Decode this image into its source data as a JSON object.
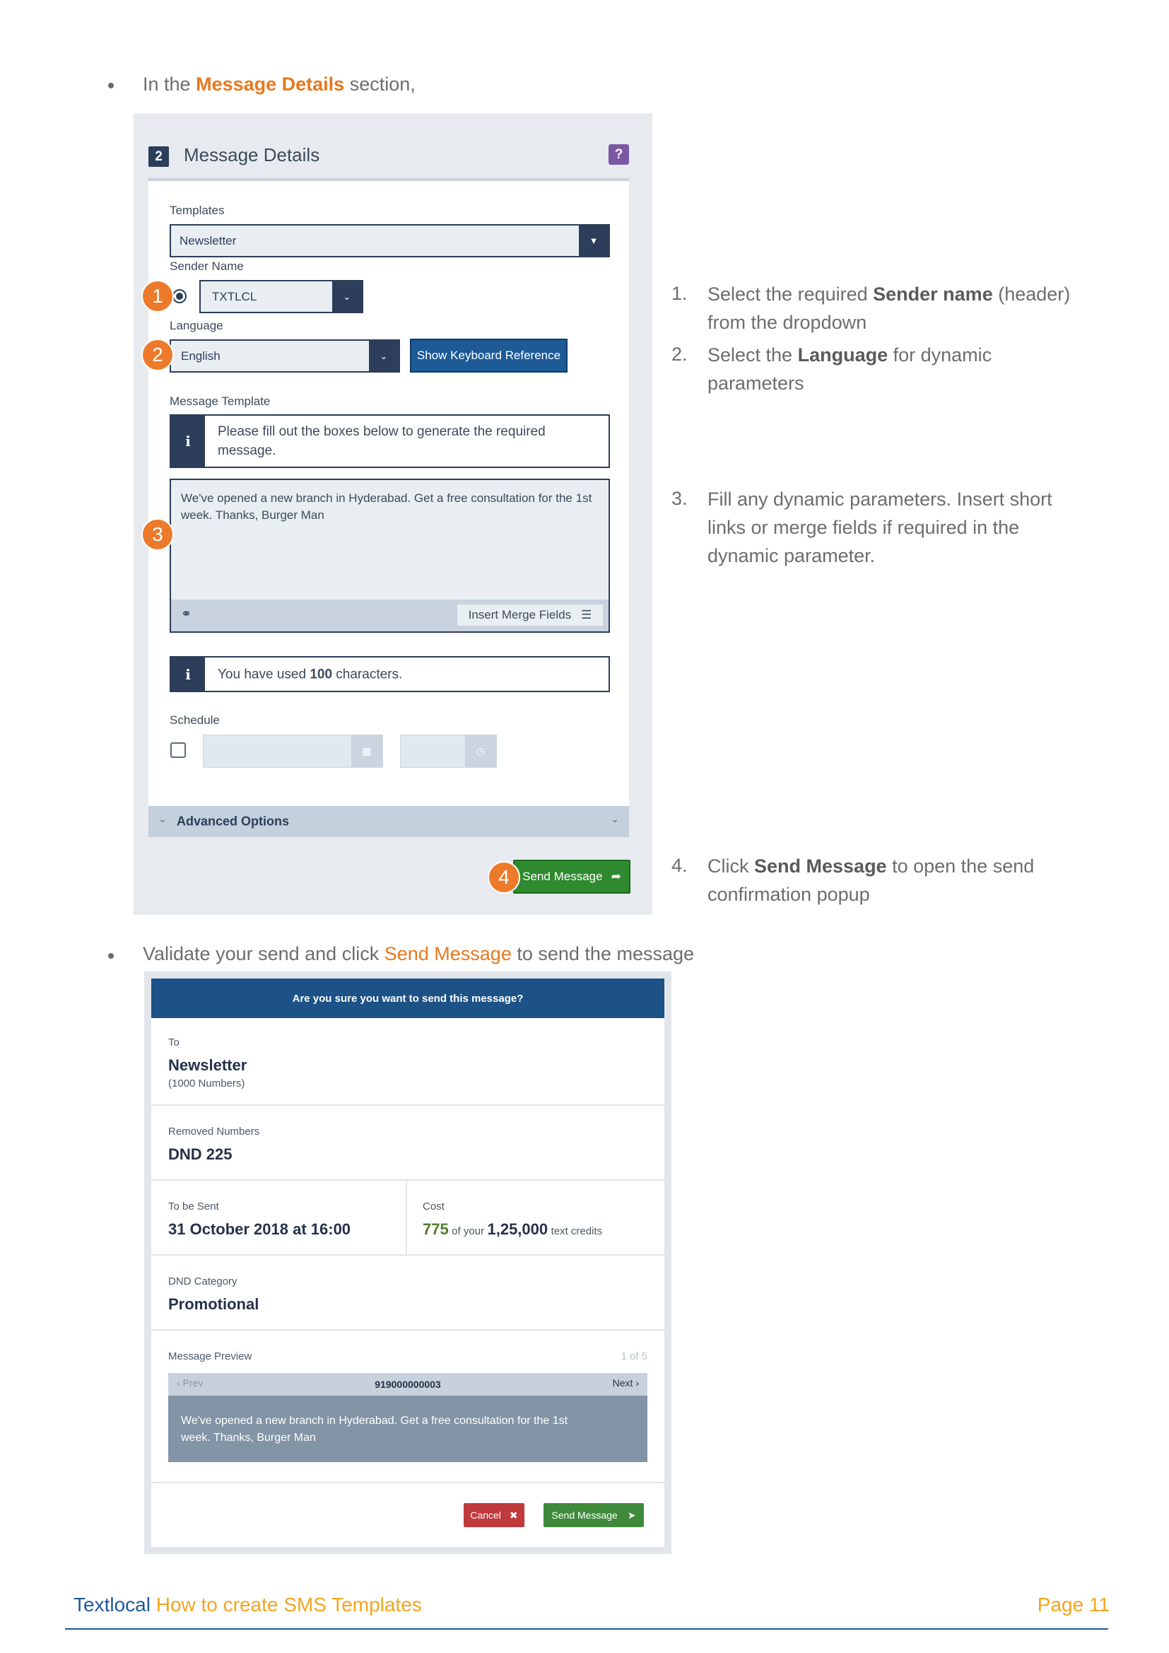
{
  "intro": {
    "prefix": "In the",
    "highlight": "Message Details",
    "suffix": "section,"
  },
  "panel": {
    "step_number": "2",
    "title": "Message Details",
    "help": "?",
    "templates_label": "Templates",
    "templates_value": "Newsletter",
    "sender_label": "Sender Name",
    "sender_value": "TXTLCL",
    "language_label": "Language",
    "language_value": "English",
    "keyboard_button": "Show Keyboard Reference",
    "message_template_label": "Message Template",
    "info_text": "Please fill out the boxes below to generate the required message.",
    "message_text": "We've opened a new branch in Hyderabad. Get a free consultation for the 1st week. Thanks, Burger Man",
    "insert_merge_fields": "Insert Merge Fields",
    "chars_prefix": "You have used",
    "chars_count": "100",
    "chars_suffix": "characters.",
    "schedule_label": "Schedule",
    "advanced_options": "Advanced Options",
    "send_button": "Send Message",
    "markers": [
      "1",
      "2",
      "3",
      "4"
    ]
  },
  "steps": [
    {
      "num": "1.",
      "pre": "Select the required ",
      "bold": "Sender name",
      "post": " (header) from the dropdown"
    },
    {
      "num": "2.",
      "pre": "Select the ",
      "bold": "Language",
      "post": " for dynamic parameters"
    },
    {
      "num": "3.",
      "pre": "Fill any dynamic parameters. Insert short links or merge fields if required in the dynamic parameter.",
      "bold": "",
      "post": ""
    },
    {
      "num": "4.",
      "pre": "Click ",
      "bold": "Send Message",
      "post": " to open the send confirmation popup"
    }
  ],
  "validate": {
    "prefix": "Validate your send and click",
    "highlight": "Send Message",
    "suffix": "to send the message"
  },
  "dialog": {
    "title": "Are you sure you want to send this message?",
    "to_label": "To",
    "to_value": "Newsletter",
    "to_count": "(1000 Numbers)",
    "removed_label": "Removed Numbers",
    "removed_value": "DND 225",
    "to_be_sent_label": "To be Sent",
    "to_be_sent_value": "31 October 2018 at 16:00",
    "cost_label": "Cost",
    "cost_value": "775",
    "cost_mid": "of your",
    "cost_total": "1,25,000",
    "cost_suffix": "text credits",
    "dnd_label": "DND Category",
    "dnd_value": "Promotional",
    "preview_label": "Message Preview",
    "preview_page": "1 of 5",
    "prev": "Prev",
    "next": "Next",
    "preview_number": "919000000003",
    "preview_text": "We've opened a new branch in Hyderabad. Get a free consultation for the 1st week. Thanks, Burger Man",
    "cancel": "Cancel",
    "send": "Send Message"
  },
  "footer": {
    "brand": "Textlocal",
    "title": "How to create SMS Templates",
    "page": "Page 11"
  }
}
